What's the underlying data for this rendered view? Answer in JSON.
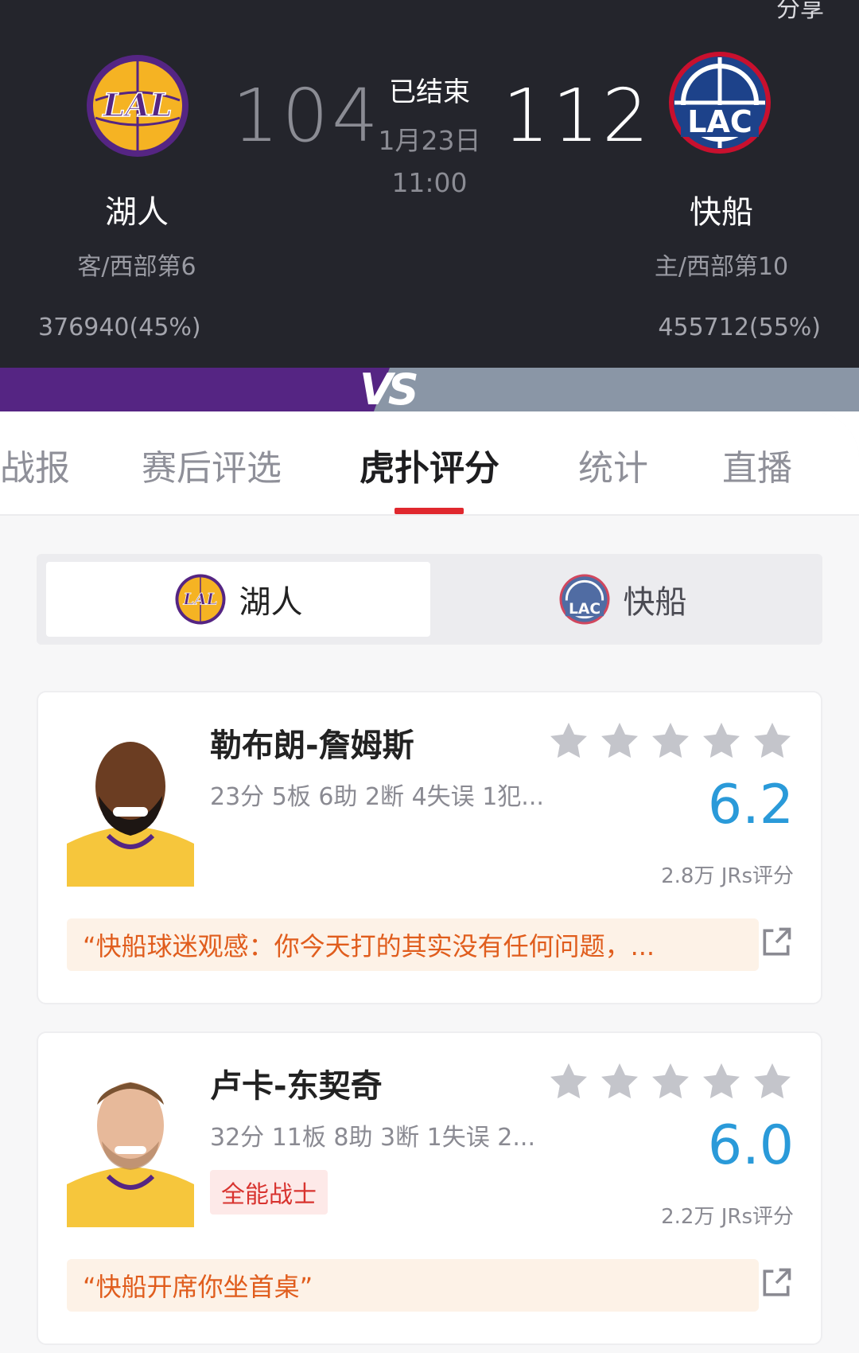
{
  "header": {
    "share": "分享",
    "away": {
      "name": "湖人",
      "rank": "客/西部第6",
      "score": "104",
      "support": "376940(45%)",
      "logo_text": "LAL"
    },
    "home": {
      "name": "快船",
      "rank": "主/西部第10",
      "score": "112",
      "support": "455712(55%)",
      "logo_text": "LAC"
    },
    "status": "已结束",
    "date": "1月23日",
    "time": "11:00"
  },
  "vs": {
    "label": "VS"
  },
  "tabs": [
    {
      "label": "战报"
    },
    {
      "label": "赛后评选"
    },
    {
      "label": "虎扑评分"
    },
    {
      "label": "统计"
    },
    {
      "label": "直播"
    }
  ],
  "team_toggle": {
    "lal": {
      "label": "湖人",
      "logo_text": "LAL"
    },
    "lac": {
      "label": "快船",
      "logo_text": "LAC"
    }
  },
  "players": [
    {
      "name": "勒布朗-詹姆斯",
      "stats": "23分 5板 6助 2断 4失误 1犯...",
      "rating": "6.2",
      "votes": "2.8万 JRs评分",
      "comment": "“快船球迷观感：你今天打的其实没有任何问题，...",
      "stars_filled": 0,
      "stars_total": 5
    },
    {
      "name": "卢卡-东契奇",
      "stats": "32分 11板 8助 3断 1失误 2...",
      "badge": "全能战士",
      "rating": "6.0",
      "votes": "2.2万 JRs评分",
      "comment": "“快船开席你坐首桌”",
      "stars_filled": 0,
      "stars_total": 5
    }
  ],
  "colors": {
    "header_bg": "#24252c",
    "lakers_purple": "#552583",
    "lakers_gold": "#f5b323",
    "clippers_gray": "#8a96a6",
    "rating_blue": "#2a9ad9",
    "active_red": "#e0282e",
    "comment_orange": "#e05d1d"
  },
  "icons": [
    "lakers-logo",
    "clippers-logo",
    "star-icon",
    "share-out-icon",
    "player-portrait"
  ]
}
